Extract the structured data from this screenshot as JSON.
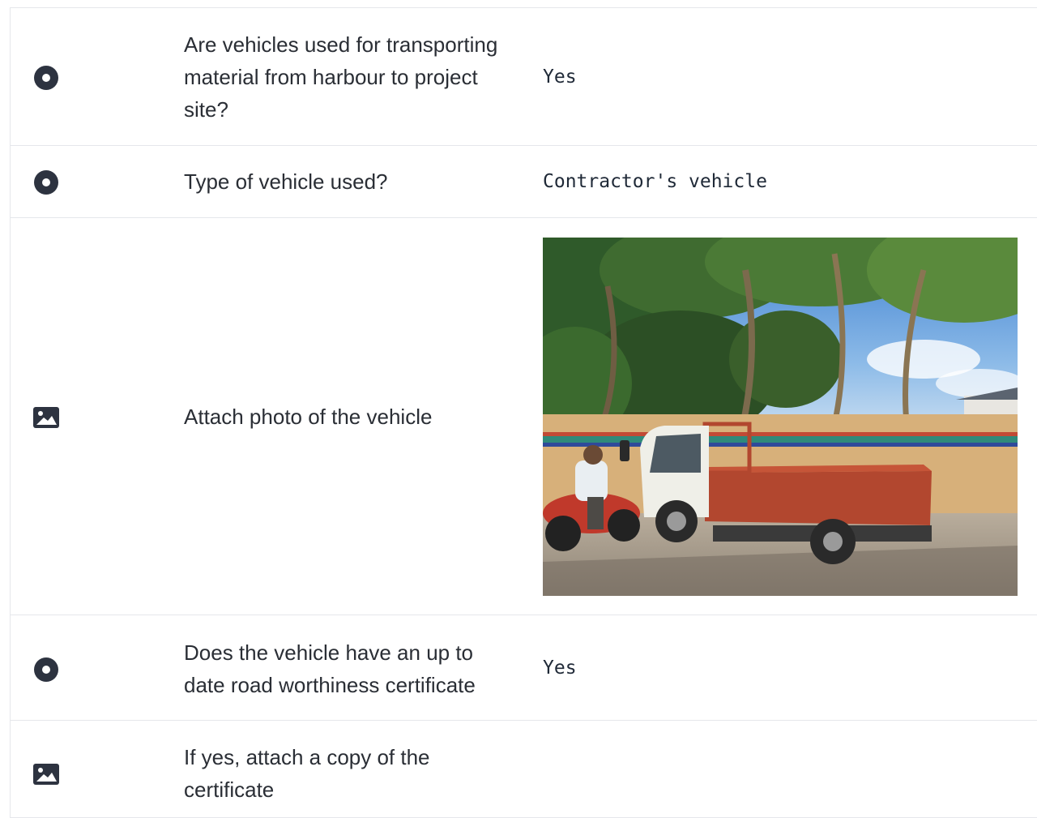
{
  "rows": [
    {
      "type": "radio",
      "icon": "radio-filled-icon",
      "question": "Are vehicles used for transporting material from harbour to project site?",
      "answer": "Yes"
    },
    {
      "type": "radio",
      "icon": "radio-filled-icon",
      "question": "Type of vehicle used?",
      "answer": "Contractor's vehicle"
    },
    {
      "type": "photo",
      "icon": "image-icon",
      "question": "Attach photo of the vehicle",
      "answer": ""
    },
    {
      "type": "radio",
      "icon": "radio-filled-icon",
      "question": "Does the vehicle have an up to date road worthiness certificate",
      "answer": "Yes"
    },
    {
      "type": "photo",
      "icon": "image-icon",
      "question": "If yes, attach a copy of the certificate",
      "answer": ""
    }
  ],
  "colors": {
    "icon": "#2d3340",
    "border": "#e5e7eb",
    "text": "#2a2e35"
  }
}
